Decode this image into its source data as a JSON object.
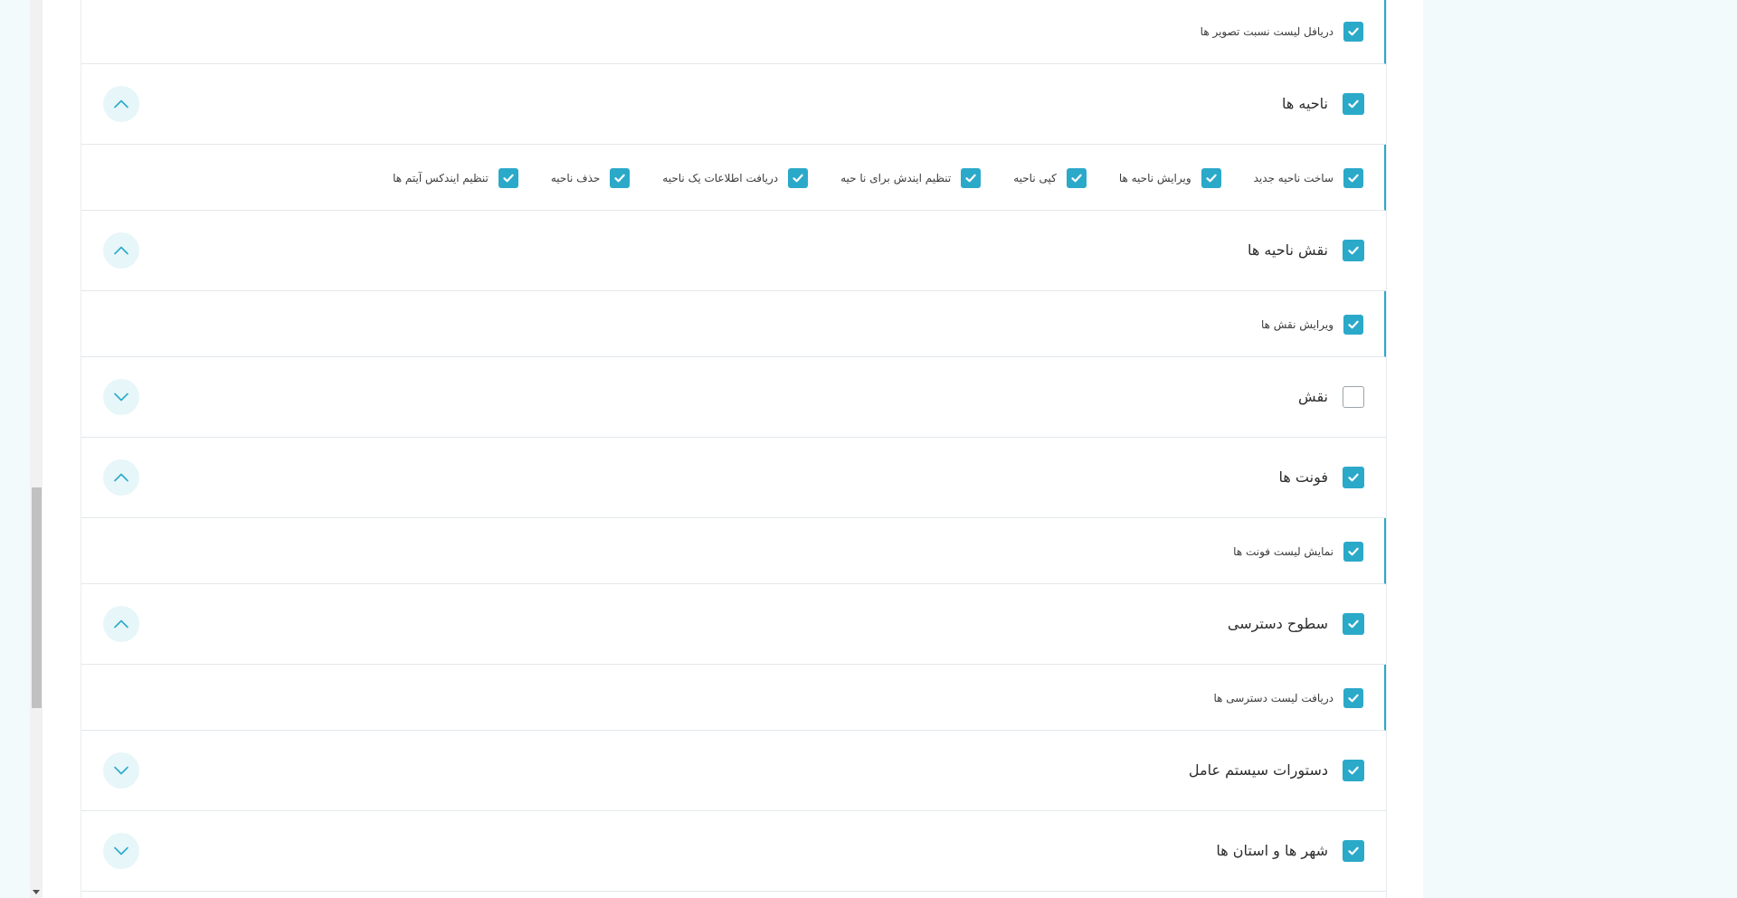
{
  "colors": {
    "accent": "#2ba9c9",
    "toggle_bg": "#e6f6f9",
    "page_bg": "#f2fafb"
  },
  "sections": [
    {
      "kind": "items",
      "items": [
        {
          "label": "دریافل لیست نسبت تصویر ها",
          "checked": true
        }
      ]
    },
    {
      "kind": "group",
      "title": "ناحیه ها",
      "checked": true,
      "toggle_icon": "chevron-up-icon"
    },
    {
      "kind": "items",
      "items": [
        {
          "label": "ساخت ناحیه جدید",
          "checked": true
        },
        {
          "label": "ویرایش ناحیه ها",
          "checked": true
        },
        {
          "label": "کپی ناحیه",
          "checked": true
        },
        {
          "label": "تنظیم ایندش برای نا حیه",
          "checked": true
        },
        {
          "label": "دریافت اطلاعات یک ناحیه",
          "checked": true
        },
        {
          "label": "حذف ناحیه",
          "checked": true
        },
        {
          "label": "تنظیم ایندکس آیتم ها",
          "checked": true
        }
      ]
    },
    {
      "kind": "group",
      "title": "نقش ناحیه ها",
      "checked": true,
      "toggle_icon": "chevron-up-icon"
    },
    {
      "kind": "items",
      "items": [
        {
          "label": "ویرایش نقش ها",
          "checked": true
        }
      ]
    },
    {
      "kind": "group",
      "title": "نقش",
      "checked": false,
      "toggle_icon": "chevron-down-icon"
    },
    {
      "kind": "group",
      "title": "فونت ها",
      "checked": true,
      "toggle_icon": "chevron-up-icon"
    },
    {
      "kind": "items",
      "items": [
        {
          "label": "نمایش لیست فونت ها",
          "checked": true
        }
      ]
    },
    {
      "kind": "group",
      "title": "سطوح دسترسی",
      "checked": true,
      "toggle_icon": "chevron-up-icon"
    },
    {
      "kind": "items",
      "items": [
        {
          "label": "دریافت لیست دسترسی ها",
          "checked": true
        }
      ]
    },
    {
      "kind": "group",
      "title": "دستورات سیستم عامل",
      "checked": true,
      "toggle_icon": "chevron-down-icon"
    },
    {
      "kind": "group",
      "title": "شهر ها و استان ها",
      "checked": true,
      "toggle_icon": "chevron-down-icon"
    }
  ]
}
